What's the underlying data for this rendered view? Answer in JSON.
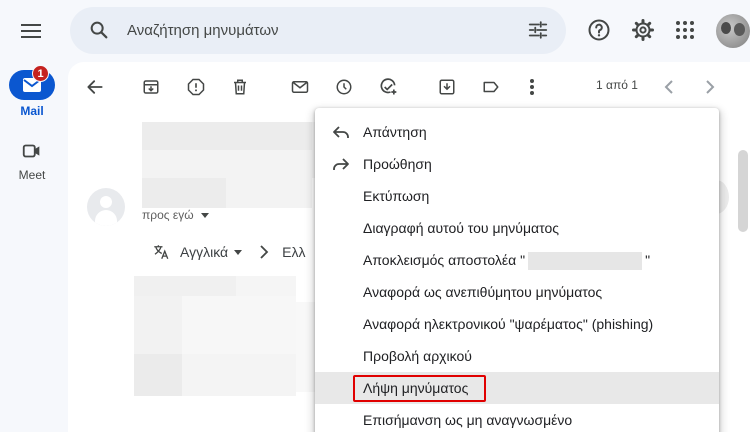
{
  "search": {
    "placeholder": "Αναζήτηση μηνυμάτων"
  },
  "nav": {
    "mail_label": "Mail",
    "mail_badge": "1",
    "meet_label": "Meet"
  },
  "toolbar": {
    "pager": "1 από 1"
  },
  "message": {
    "to_me": "προς εγώ",
    "translate_from": "Αγγλικά",
    "translate_to_partial": "Ελλ"
  },
  "menu": {
    "items": [
      {
        "label": "Απάντηση",
        "icon": "reply-icon"
      },
      {
        "label": "Προώθηση",
        "icon": "forward-icon"
      },
      {
        "label": "Εκτύπωση"
      },
      {
        "label": "Διαγραφή αυτού του μηνύματος"
      },
      {
        "label_start": "Αποκλεισμός αποστολέα \"",
        "label_end": "\""
      },
      {
        "label": "Αναφορά ως ανεπιθύμητου μηνύματος"
      },
      {
        "label": "Αναφορά ηλεκτρονικού \"ψαρέματος\" (phishing)"
      },
      {
        "label": "Προβολή αρχικού"
      },
      {
        "label": "Λήψη μηνύματος",
        "highlighted": true
      },
      {
        "label": "Επισήμανση ως μη αναγνωσμένο"
      }
    ]
  },
  "colors": {
    "accent": "#0b57d0",
    "badge": "#c5221f",
    "highlight_box": "#e00000"
  }
}
